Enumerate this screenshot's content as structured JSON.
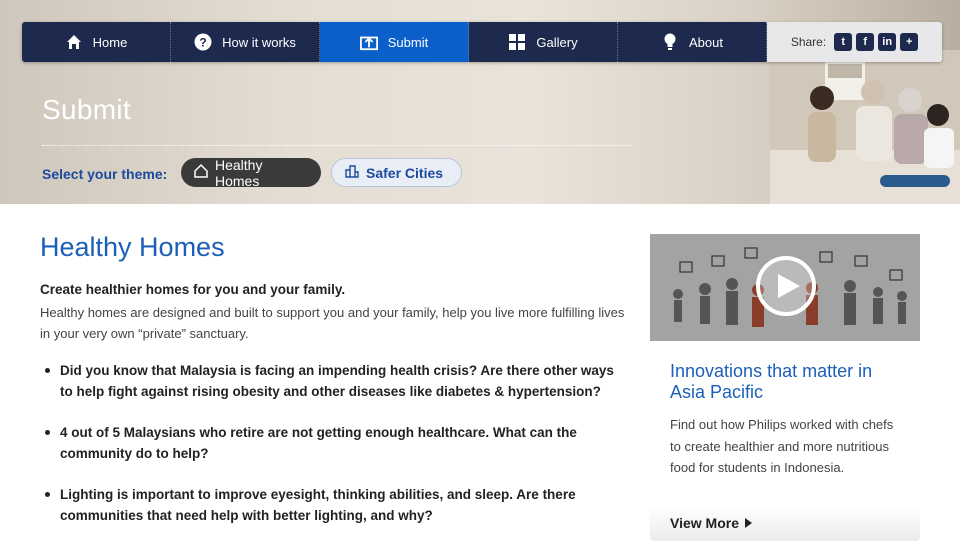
{
  "nav": {
    "items": [
      {
        "label": "Home",
        "icon": "home-icon"
      },
      {
        "label": "How it works",
        "icon": "question-icon"
      },
      {
        "label": "Submit",
        "icon": "upload-icon",
        "active": true
      },
      {
        "label": "Gallery",
        "icon": "grid-icon"
      },
      {
        "label": "About",
        "icon": "lightbulb-icon"
      }
    ],
    "share_label": "Share:",
    "share_buttons": [
      "twitter-icon",
      "facebook-icon",
      "linkedin-icon",
      "plus-icon"
    ]
  },
  "hero": {
    "title": "Submit",
    "theme_label": "Select your theme:",
    "themes": [
      {
        "label": "Healthy Homes",
        "icon": "house-outline-icon",
        "selected": true
      },
      {
        "label": "Safer Cities",
        "icon": "city-icon",
        "selected": false
      }
    ]
  },
  "main": {
    "title": "Healthy Homes",
    "intro_bold": "Create healthier homes for you and your family.",
    "intro_text": "Healthy homes are designed and built to support you and your family, help you live more fulfilling lives in your very own “private” sanctuary.",
    "bullets": [
      "Did you know that Malaysia is facing an impending health crisis? Are there other ways to help fight against rising obesity and other diseases like diabetes & hypertension?",
      "4 out of 5 Malaysians who retire are not getting enough healthcare. What can the community do to help?",
      "Lighting is important to improve eyesight, thinking abilities, and sleep. Are there communities that need help with better lighting, and why?"
    ]
  },
  "sidebar": {
    "card_title": "Innovations that matter in Asia Pacific",
    "card_text": "Find out how Philips worked with chefs to create healthier and more nutritious food for students in Indonesia.",
    "more_label": "View More"
  },
  "colors": {
    "nav_bg": "#1e2a4d",
    "nav_active": "#0a5fcb",
    "accent_blue": "#1c5fb8",
    "theme_dark": "#3a3a3a"
  }
}
